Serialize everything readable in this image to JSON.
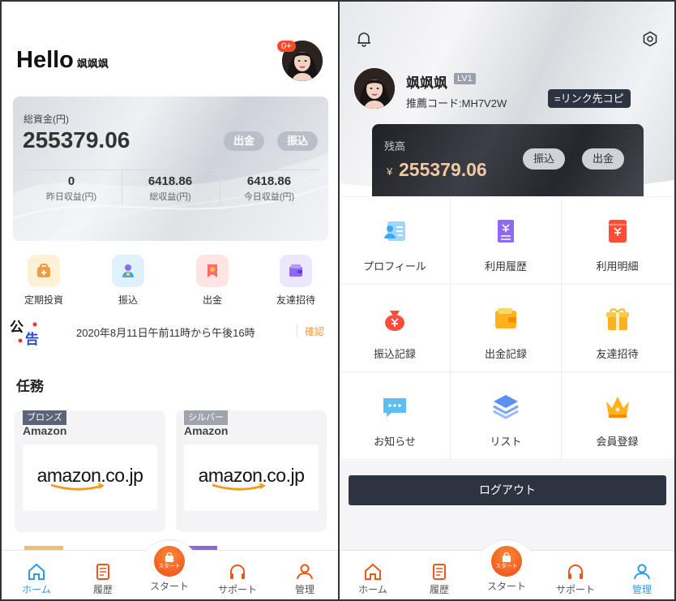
{
  "left": {
    "greeting": "Hello",
    "username": "飒飒飒",
    "notification_badge": "0+",
    "asset_card": {
      "label": "総資金(円)",
      "total": "255379.06",
      "withdraw_label": "出金",
      "deposit_label": "振込",
      "stats": [
        {
          "value": "0",
          "label": "昨日収益(円)"
        },
        {
          "value": "6418.86",
          "label": "総収益(円)"
        },
        {
          "value": "6418.86",
          "label": "今日収益(円)"
        }
      ]
    },
    "quick_actions": [
      {
        "label": "定期投資",
        "icon": "fixed-investment-icon",
        "color": "#ff9a3c"
      },
      {
        "label": "振込",
        "icon": "deposit-person-icon",
        "color": "#3ea7f5"
      },
      {
        "label": "出金",
        "icon": "withdraw-icon",
        "color": "#ff6b6b"
      },
      {
        "label": "友達招待",
        "icon": "invite-friends-icon",
        "color": "#8c6bf2"
      }
    ],
    "notice": {
      "icon_text_1": "公",
      "icon_text_2": "告",
      "text": "2020年8月11日午前11時から午後16時",
      "confirm_label": "確認"
    },
    "tasks_title": "任務",
    "tasks": [
      {
        "tier": "ブロンズ",
        "tier_color": "#5b6478",
        "name": "Amazon",
        "logo_main": "amazon",
        "logo_suffix": ".co.jp"
      },
      {
        "tier": "シルバー",
        "tier_color": "#a0a4ad",
        "name": "Amazon",
        "logo_main": "amazon",
        "logo_suffix": ".co.jp"
      }
    ],
    "tabbar": {
      "home": "ホーム",
      "history": "履歴",
      "start": "スタート",
      "start_icon_text": "スタート",
      "support": "サポート",
      "manage": "管理"
    }
  },
  "right": {
    "username": "飒飒飒",
    "level": "LV1",
    "referral": "推薦コード:MH7V2W",
    "copy_link_label": "=リンク先コピ",
    "balance": {
      "label": "残高",
      "currency": "¥",
      "value": "255379.06",
      "deposit_label": "振込",
      "withdraw_label": "出金"
    },
    "menu": [
      {
        "label": "プロフィール",
        "icon": "profile-card-icon"
      },
      {
        "label": "利用履歴",
        "icon": "usage-history-icon"
      },
      {
        "label": "利用明細",
        "icon": "usage-detail-icon"
      },
      {
        "label": "振込記録",
        "icon": "money-bag-icon"
      },
      {
        "label": "出金記録",
        "icon": "wallet-icon"
      },
      {
        "label": "友達招待",
        "icon": "gift-icon"
      },
      {
        "label": "お知らせ",
        "icon": "message-icon"
      },
      {
        "label": "リスト",
        "icon": "layers-icon"
      },
      {
        "label": "会員登録",
        "icon": "crown-icon"
      }
    ],
    "logout_label": "ログアウト",
    "tabbar": {
      "home": "ホーム",
      "history": "履歴",
      "start": "スタート",
      "start_icon_text": "スタート",
      "support": "サポート",
      "manage": "管理"
    }
  }
}
